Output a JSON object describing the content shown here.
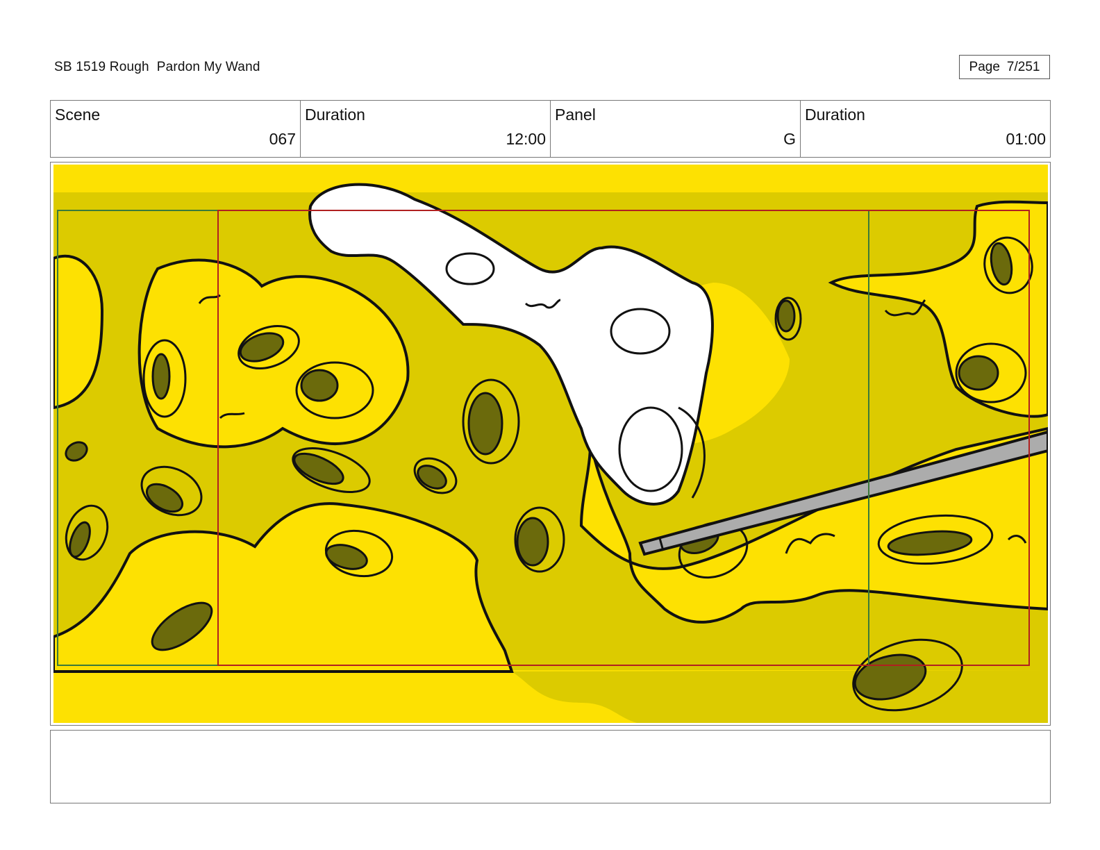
{
  "header": {
    "title": "SB 1519 Rough  Pardon My Wand",
    "page_label": "Page",
    "page_number": "7/251"
  },
  "info": {
    "scene_label": "Scene",
    "scene_value": "067",
    "scene_duration_label": "Duration",
    "scene_duration_value": "12:00",
    "panel_label": "Panel",
    "panel_value": "G",
    "panel_duration_label": "Duration",
    "panel_duration_value": "01:00"
  },
  "panel": {
    "description": "",
    "colors": {
      "bright_yellow": "#fde102",
      "shadow_yellow": "#dccb00",
      "hole_olive": "#6b6a0c",
      "white_cheese": "#ffffff",
      "wand_gray": "#acacac",
      "outline": "#111111",
      "green_frame": "#3a7a3a",
      "red_frame": "#b02020"
    }
  },
  "notes": {
    "text": ""
  }
}
